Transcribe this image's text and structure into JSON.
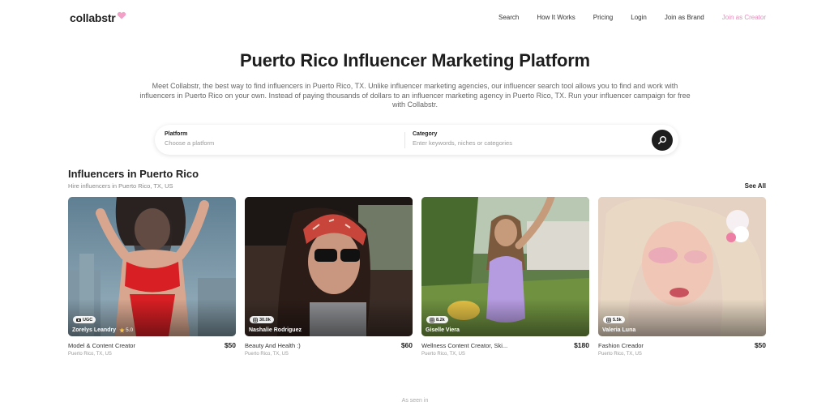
{
  "nav": {
    "logo": "collabstr",
    "links": [
      "Search",
      "How It Works",
      "Pricing",
      "Login",
      "Join as Brand"
    ],
    "creator_link": "Join as Creator"
  },
  "hero": {
    "title": "Puerto Rico Influencer Marketing Platform",
    "description": "Meet Collabstr, the best way to find influencers in Puerto Rico, TX. Unlike influencer marketing agencies, our influencer search tool allows you to find and work with influencers in Puerto Rico on your own. Instead of paying thousands of dollars to an influencer marketing agency in Puerto Rico, TX. Run your influencer campaign for free with Collabstr."
  },
  "search": {
    "platform_label": "Platform",
    "platform_placeholder": "Choose a platform",
    "category_label": "Category",
    "category_placeholder": "Enter keywords, niches or categories",
    "button_icon": "search-icon"
  },
  "section": {
    "title": "Influencers in Puerto Rico",
    "subtitle": "Hire influencers in Puerto Rico, TX, US",
    "see_all": "See All"
  },
  "cards": [
    {
      "badge": "UGC",
      "badge_icon": "camera-icon",
      "name": "Zorelys Leandry",
      "rating": "5.0",
      "category": "Model & Content Creator",
      "price": "$50",
      "location": "Puerto Rico, TX, US"
    },
    {
      "badge": "30.0k",
      "badge_icon": "instagram-icon",
      "name": "Nashalie Rodriguez",
      "rating": "",
      "category": "Beauty And Health :)",
      "price": "$60",
      "location": "Puerto Rico, TX, US"
    },
    {
      "badge": "8.2k",
      "badge_icon": "instagram-icon",
      "name": "Giselle Viera",
      "rating": "",
      "category": "Wellness Content Creator, Ski...",
      "price": "$180",
      "location": "Puerto Rico, TX, US"
    },
    {
      "badge": "5.5k",
      "badge_icon": "instagram-icon",
      "name": "Valeria Luna",
      "rating": "",
      "category": "Fashion Creador",
      "price": "$50",
      "location": "Puerto Rico, TX, US"
    }
  ],
  "footer": {
    "as_seen_in": "As seen in"
  },
  "colors": {
    "creator_pink": "#e98bbd",
    "search_button": "#1e1e1e"
  }
}
